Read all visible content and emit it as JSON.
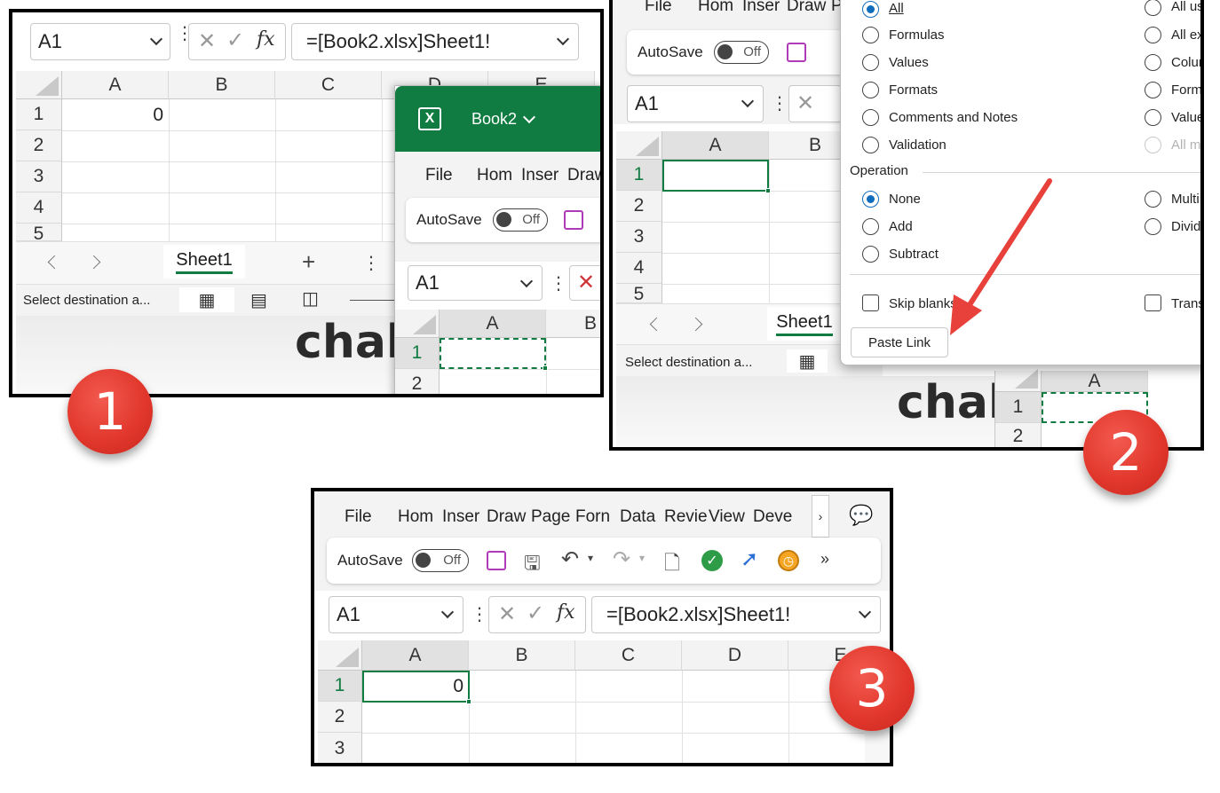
{
  "panel1": {
    "name_box": "A1",
    "formula": "=[Book2.xlsx]Sheet1!",
    "columns": [
      "A",
      "B",
      "C",
      "D",
      "E"
    ],
    "rows": [
      "1",
      "2",
      "3",
      "4",
      "5"
    ],
    "cell_a1": "0",
    "sheet_tab": "Sheet1",
    "status": "Select destination a...",
    "big_text": "chal",
    "book2": {
      "title": "Book2",
      "menu": [
        "File",
        "Hom",
        "Inser",
        "Draw"
      ],
      "autosave": "AutoSave",
      "toggle": "Off",
      "name_box": "A1",
      "columns": [
        "A",
        "B"
      ],
      "rows": [
        "1",
        "2"
      ]
    }
  },
  "panel2": {
    "menu": [
      "File",
      "Hom",
      "Inser",
      "Draw",
      "P"
    ],
    "autosave": "AutoSave",
    "toggle": "Off",
    "name_box": "A1",
    "columns": [
      "A",
      "B"
    ],
    "rows": [
      "1",
      "2",
      "3",
      "4",
      "5"
    ],
    "sheet_tab": "Sheet1",
    "status": "Select destination a...",
    "big_text": "chal",
    "back_column": "A",
    "back_rows": [
      "1",
      "2"
    ],
    "dialog": {
      "paste_left": [
        "All",
        "Formulas",
        "Values",
        "Formats",
        "Comments and Notes",
        "Validation"
      ],
      "paste_right": [
        "All us",
        "All ex",
        "Colur",
        "Form",
        "Value",
        "All m"
      ],
      "operation_title": "Operation",
      "operation_left": [
        "None",
        "Add",
        "Subtract"
      ],
      "operation_right": [
        "Multi",
        "Divid"
      ],
      "skip_blanks": "Skip blanks",
      "transpose": "Trans",
      "paste_link": "Paste Link"
    }
  },
  "panel3": {
    "menu": [
      "File",
      "Hom",
      "Inser",
      "Draw",
      "Page",
      "Forn",
      "Data",
      "Revie",
      "View",
      "Deve"
    ],
    "autosave": "AutoSave",
    "toggle": "Off",
    "name_box": "A1",
    "formula": "=[Book2.xlsx]Sheet1!",
    "columns": [
      "A",
      "B",
      "C",
      "D",
      "E"
    ],
    "rows": [
      "1",
      "2",
      "3"
    ],
    "cell_a1": "0"
  },
  "badges": [
    "1",
    "2",
    "3"
  ],
  "colors": {
    "excel_green": "#107c41",
    "badge_red": "#e2382d",
    "arrow_red": "#e8403a",
    "radio_blue": "#0f6cbd"
  }
}
